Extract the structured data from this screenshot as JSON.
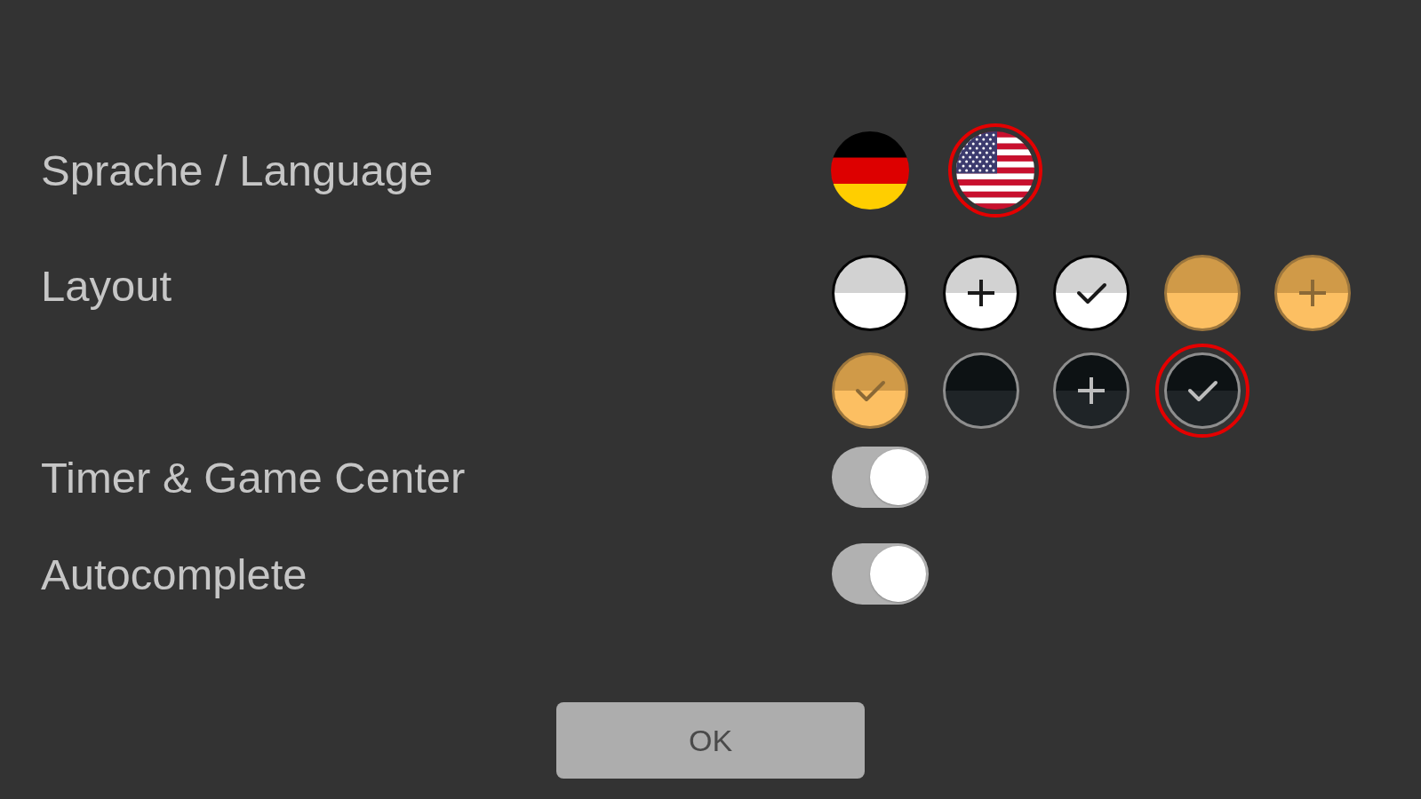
{
  "language": {
    "label": "Sprache / Language",
    "options": [
      {
        "kind": "de",
        "selected": false
      },
      {
        "kind": "us",
        "selected": true
      }
    ]
  },
  "layout": {
    "label": "Layout",
    "options": [
      {
        "color": "#ffffff",
        "kind": "plain",
        "selected": false
      },
      {
        "color": "#ffffff",
        "kind": "plus",
        "selected": false
      },
      {
        "color": "#ffffff",
        "kind": "check",
        "selected": false
      },
      {
        "color": "#fcbf62",
        "kind": "plain",
        "selected": false
      },
      {
        "color": "#fcbf62",
        "kind": "plus",
        "selected": false
      },
      {
        "color": "#fcbf62",
        "kind": "check",
        "selected": false
      },
      {
        "color": "#1f2427",
        "kind": "plain",
        "selected": false
      },
      {
        "color": "#1f2427",
        "kind": "plus",
        "selected": false
      },
      {
        "color": "#1f2427",
        "kind": "check",
        "selected": true
      }
    ]
  },
  "toggles": [
    {
      "label": "Timer & Game Center",
      "on": true
    },
    {
      "label": "Autocomplete",
      "on": true
    }
  ],
  "ok_button": {
    "label": "OK"
  }
}
